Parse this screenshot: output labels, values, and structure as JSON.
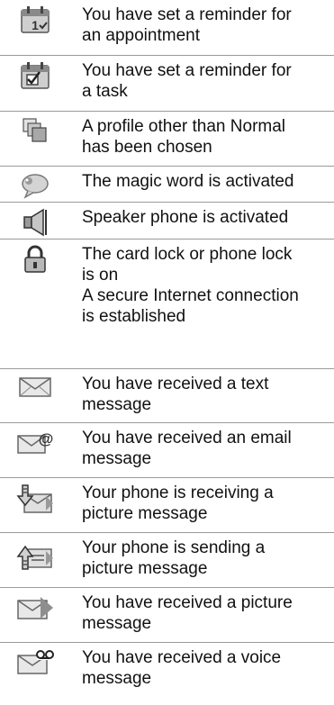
{
  "rows": [
    {
      "icon": "calendar-appointment-icon",
      "lines": [
        "You have set a reminder for",
        "an appointment"
      ]
    },
    {
      "icon": "calendar-task-icon",
      "lines": [
        "You have set a reminder for",
        "a task"
      ]
    },
    {
      "icon": "profile-icon",
      "lines": [
        "A profile other than Normal",
        "has been chosen"
      ]
    },
    {
      "icon": "magic-word-icon",
      "lines": [
        "The magic word is activated"
      ]
    },
    {
      "icon": "speaker-icon",
      "lines": [
        "Speaker phone is activated"
      ]
    },
    {
      "icon": "padlock-icon",
      "lines": [
        "The card lock or phone lock",
        "is on",
        "A secure Internet connection",
        "is established"
      ]
    },
    {
      "icon": "text-message-icon",
      "lines": [
        "You have received a text",
        "message"
      ]
    },
    {
      "icon": "email-message-icon",
      "lines": [
        "You have received an email",
        "message"
      ]
    },
    {
      "icon": "picture-receiving-icon",
      "lines": [
        "Your phone is receiving a",
        "picture message"
      ]
    },
    {
      "icon": "picture-sending-icon",
      "lines": [
        "Your phone is sending a",
        "picture message"
      ]
    },
    {
      "icon": "picture-message-icon",
      "lines": [
        "You have received a picture",
        "message"
      ]
    },
    {
      "icon": "voice-message-icon",
      "lines": [
        "You have received a voice",
        "message"
      ]
    }
  ]
}
